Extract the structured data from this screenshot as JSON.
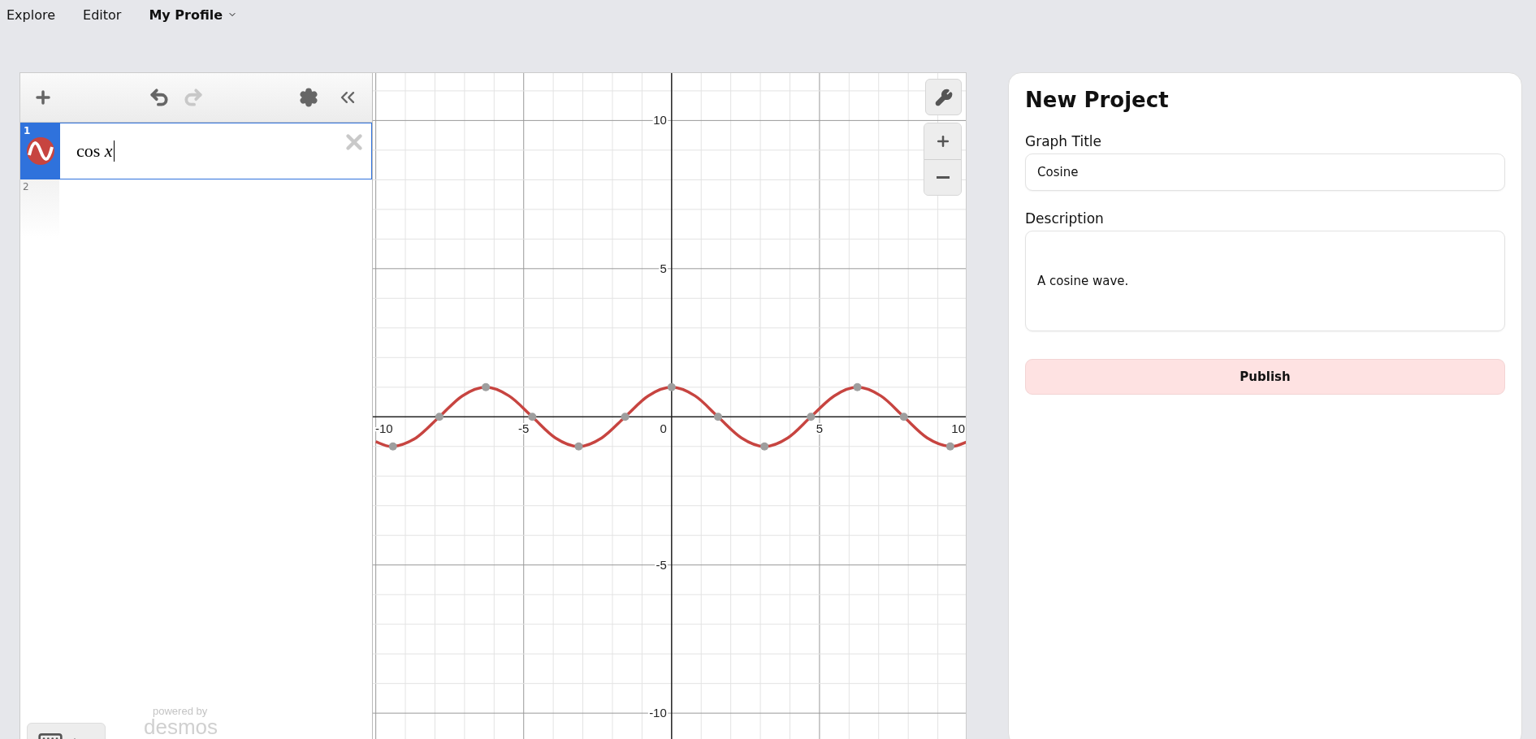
{
  "nav": [
    {
      "label": "Explore",
      "selected": false,
      "dropdown": false
    },
    {
      "label": "Editor",
      "selected": false,
      "dropdown": false
    },
    {
      "label": "My Profile",
      "selected": true,
      "dropdown": true
    }
  ],
  "calculator": {
    "toolbar": {
      "undo": {
        "disabled": false
      },
      "redo": {
        "disabled": true
      }
    },
    "expressions": [
      {
        "index": "1",
        "latex": "cos *x*",
        "color": "#c74440",
        "selected": true
      },
      {
        "index": "2",
        "selected": false
      }
    ],
    "powered_by": "powered by",
    "logo": "desmos",
    "graph": {
      "chart_data": {
        "type": "line",
        "x": [
          -10,
          -9.42,
          -8.64,
          -7.85,
          -7.07,
          -6.28,
          -5.5,
          -4.71,
          -3.93,
          -3.14,
          -2.36,
          -1.57,
          -0.79,
          0,
          0.79,
          1.57,
          2.36,
          3.14,
          3.93,
          4.71,
          5.5,
          6.28,
          7.07,
          7.85,
          8.64,
          9.42,
          10
        ],
        "series": [
          {
            "marker": false,
            "color": "#c74440",
            "values": [
              -0.84,
              -1,
              -0.71,
              0,
              0.71,
              1,
              0.71,
              0,
              -0.71,
              -1,
              -0.71,
              0,
              0.71,
              1,
              0.71,
              0,
              -0.71,
              -1,
              -0.71,
              0,
              0.71,
              1,
              0.71,
              0,
              -0.71,
              -1,
              -0.84
            ]
          },
          {
            "marker": true,
            "color": "#9e9e9e",
            "values": [
              null,
              -1,
              null,
              0,
              null,
              1,
              null,
              0,
              null,
              -1,
              null,
              0,
              null,
              1,
              null,
              0,
              null,
              -1,
              null,
              0,
              null,
              1,
              null,
              0,
              null,
              -1,
              null
            ]
          }
        ],
        "grid": true,
        "xlim": [
          -10.1,
          10.0
        ],
        "ylim": [
          -10.9,
          11.6
        ],
        "xticks": [
          -10,
          -5,
          {
            "value": 0,
            "label": "0"
          },
          5,
          10
        ],
        "yticks": [
          -10,
          -5,
          5,
          10
        ]
      }
    }
  },
  "project": {
    "title": "New Project",
    "fields": [
      {
        "kind": "input",
        "label": "Graph Title",
        "value": "Cosine"
      },
      {
        "kind": "textarea",
        "label": "Description",
        "value": "A cosine wave."
      }
    ],
    "button": "Publish"
  }
}
